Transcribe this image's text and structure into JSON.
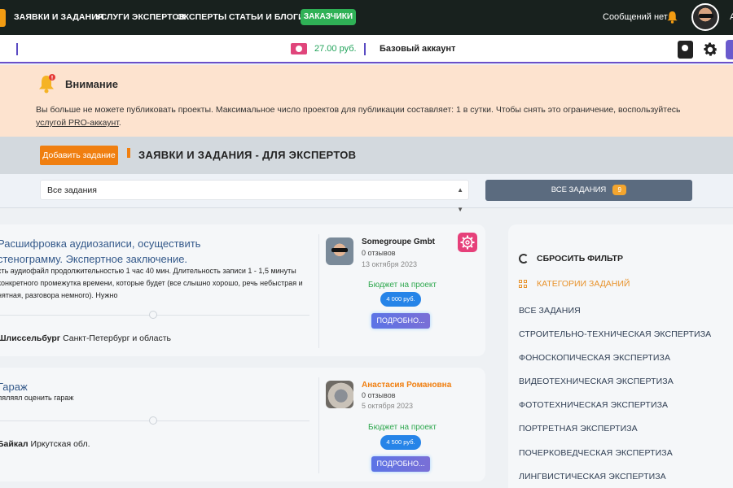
{
  "nav": {
    "items": [
      "ЗАЯВКИ И ЗАДАНИЯ",
      "УСЛУГИ ЭКСПЕРТОВ",
      "ЭКСПЕРТЫ",
      "СТАТЬИ И БЛОГИ"
    ],
    "active": "ЗАКАЗЧИКИ",
    "messages": "Сообщений нет",
    "cut_letter": "А"
  },
  "account_bar": {
    "balance": "27.00 руб.",
    "account_type": "Базовый аккаунт"
  },
  "alert": {
    "title": "Внимание",
    "text_before": "Вы больше не можете публиковать проекты. Максимальное число проектов для публикации составляет: 1 в сутки. Чтобы снять это ограничение, воспользуйтесь ",
    "link_text": "услугой PRO-аккаунт",
    "text_after": "."
  },
  "page_header": {
    "add_button": "Добавить задание",
    "title": "ЗАЯВКИ И ЗАДАНИЯ - ДЛЯ ЭКСПЕРТОВ"
  },
  "filter": {
    "select_value": "Все задания",
    "all_button": "ВСЕ ЗАДАНИЯ",
    "all_count": "9"
  },
  "tasks": [
    {
      "title_line1": "Расшифровка аудиозаписи, осуществить",
      "title_line2": "стенограмму. Экспертное заключение.",
      "desc_line1": "сть аудиофайл продолжительностью 1 час 40 мин. Длительность записи 1 - 1,5 минуты",
      "desc_line2": "конкретного промежутка времени, которые будет (все слышно хорошо, речь небыстрая и",
      "desc_line3": "нятная, разговора немного). Нужно",
      "city": "Шлиссельбург",
      "region": "Санкт-Петербург и область",
      "author": "Somegroupe Gmbt",
      "author_color": "#1f1f1f",
      "reviews": "0 отзывов",
      "date": "13 октября 2023",
      "budget_label": "Бюджет на проект",
      "budget": "4 000 руб.",
      "more": "ПОДРОБНО..."
    },
    {
      "title_line1": "Гараж",
      "desc_line1": "ляляял оценить гараж",
      "city": "Байкал",
      "region": "Иркутская обл.",
      "author": "Анастасия Романовна",
      "author_color": "#f07f10",
      "reviews": "0 отзывов",
      "date": "5 октября 2023",
      "budget_label": "Бюджет на проект",
      "budget": "4 500 руб.",
      "more": "ПОДРОБНО..."
    }
  ],
  "sidebar": {
    "reset": "СБРОСИТЬ ФИЛЬТР",
    "categories_title": "КАТЕГОРИИ ЗАДАНИЙ",
    "categories": [
      "ВСЕ ЗАДАНИЯ",
      "СТРОИТЕЛЬНО-ТЕХНИЧЕСКАЯ ЭКСПЕРТИЗА",
      "ФОНОСКОПИЧЕСКАЯ ЭКСПЕРТИЗА",
      "ВИДЕОТЕХНИЧЕСКАЯ ЭКСПЕРТИЗА",
      "ФОТОТЕХНИЧЕСКАЯ ЭКСПЕРТИЗА",
      "ПОРТРЕТНАЯ ЭКСПЕРТИЗА",
      "ПОЧЕРКОВЕДЧЕСКАЯ ЭКСПЕРТИЗА",
      "ЛИНГВИСТИЧЕСКАЯ ЭКСПЕРТИЗА"
    ]
  },
  "colors": {
    "accent_orange": "#f07f10",
    "nav_bg": "#18211e",
    "active_green": "#2fb156",
    "budget_green": "#2fa84f",
    "link_blue": "#34598a"
  }
}
